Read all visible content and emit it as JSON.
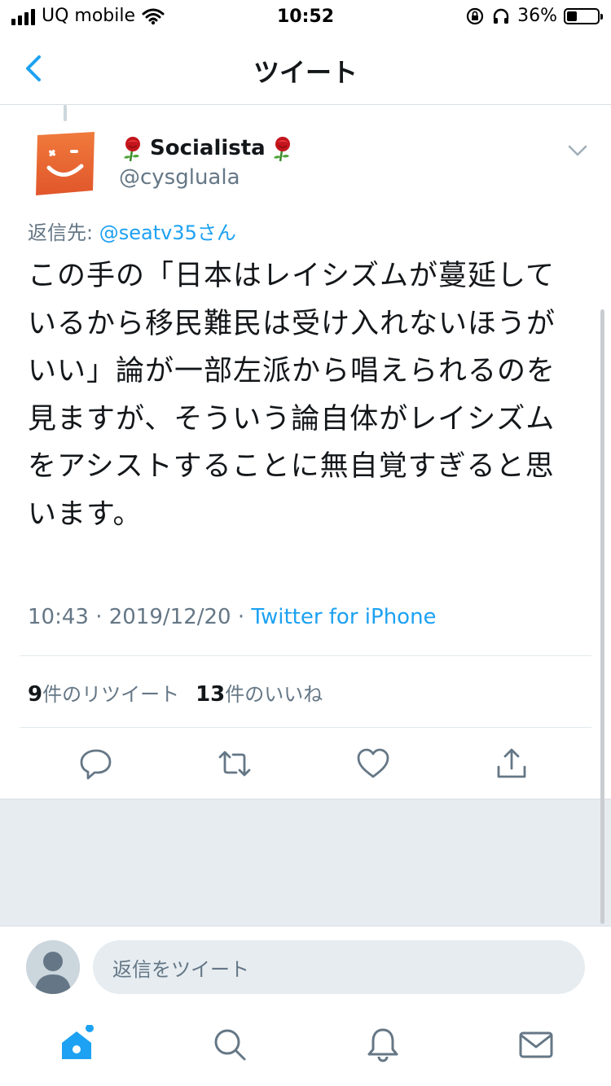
{
  "status_bar": {
    "carrier": "UQ mobile",
    "time": "10:52",
    "battery": "36%"
  },
  "nav": {
    "title": "ツイート"
  },
  "tweet": {
    "display_name": "Socialista",
    "username": "@cysgluala",
    "reply_prefix": "返信先: ",
    "reply_mention": "@seatv35さん",
    "text": "この手の「日本はレイシズムが蔓延しているから移民難民は受け入れないほうがいい」論が一部左派から唱えられるのを見ますが、そういう論自体がレイシズムをアシストすることに無自覚すぎると思います。",
    "timestamp": "10:43 · 2019/12/20 · ",
    "source": "Twitter for iPhone",
    "retweet_count": "9",
    "retweet_label": "件のリツイート",
    "like_count": "13",
    "like_label": "件のいいね"
  },
  "compose": {
    "placeholder": "返信をツイート"
  },
  "colors": {
    "accent": "#1da1f2",
    "secondary_text": "#657786",
    "divider": "#e1e8ed"
  }
}
